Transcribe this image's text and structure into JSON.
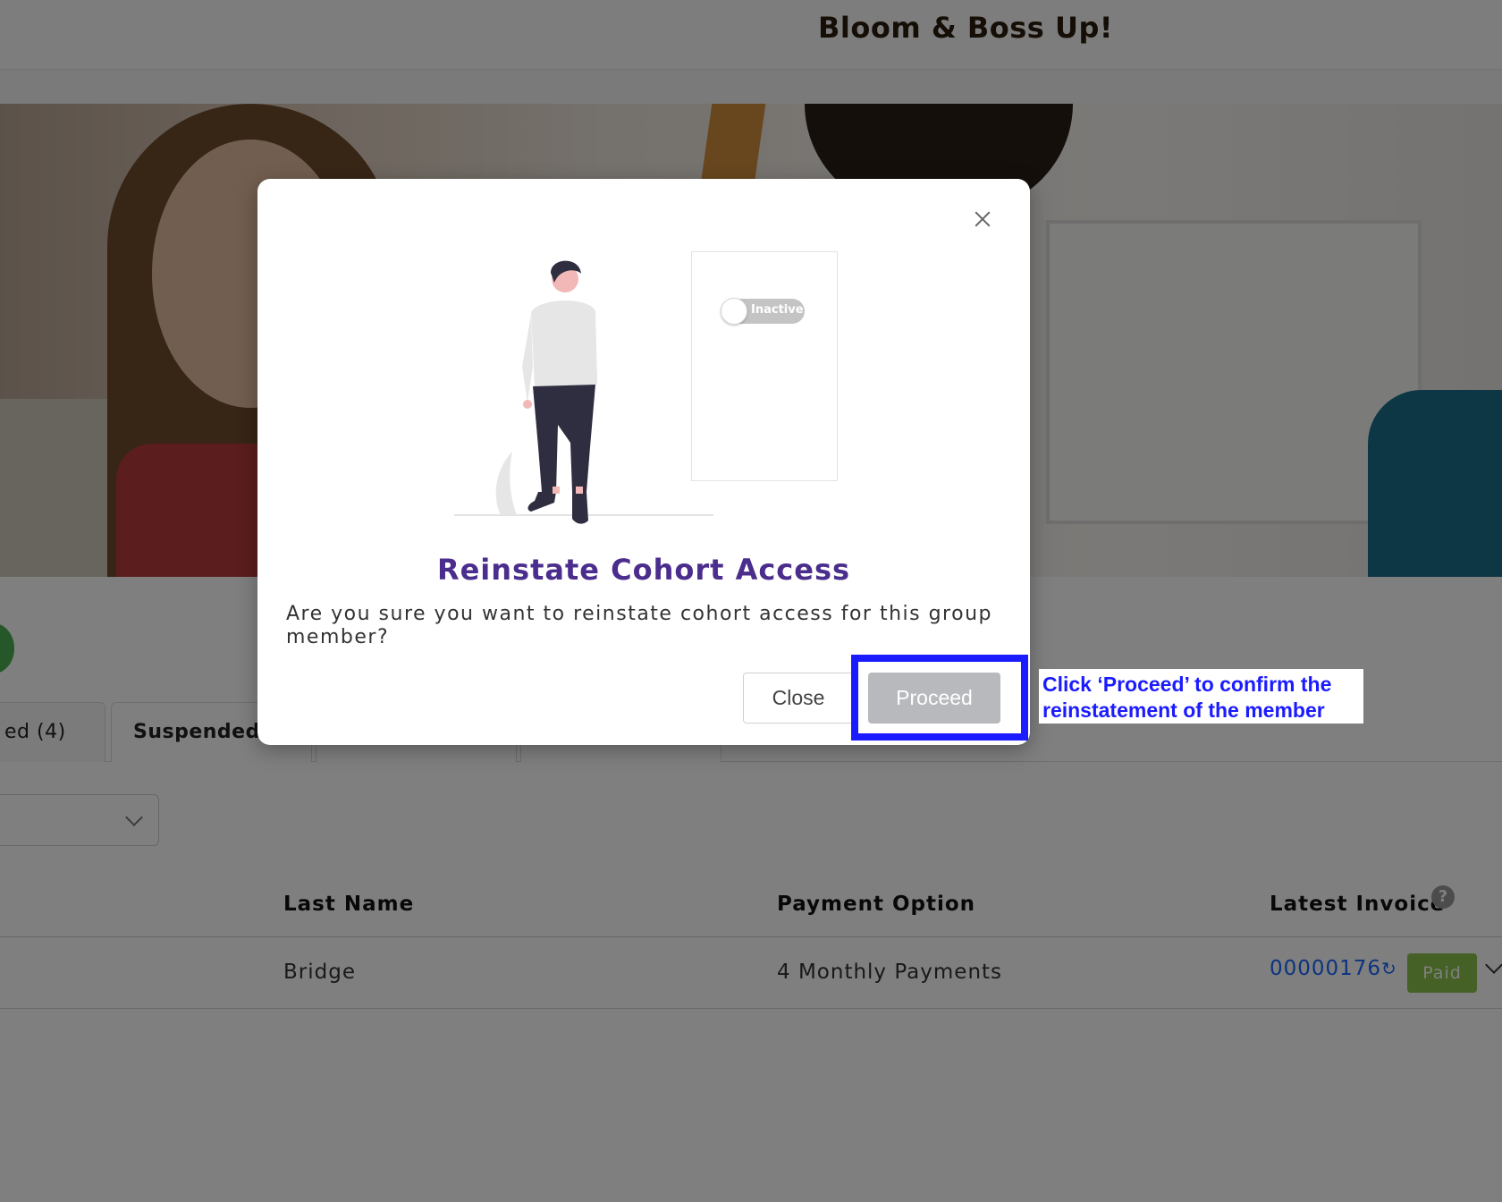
{
  "header": {
    "brand": "Bloom & Boss Up!"
  },
  "tabs": [
    {
      "label": "ed (4)"
    },
    {
      "label": "Suspended"
    }
  ],
  "table": {
    "columns": {
      "last_name": "Last Name",
      "payment_option": "Payment Option",
      "latest_invoice": "Latest Invoice"
    },
    "rows": [
      {
        "last_name": "Bridge",
        "payment_option": "4 Monthly Payments",
        "invoice": "00000176",
        "status": "Paid"
      }
    ]
  },
  "modal": {
    "toggle_label": "Inactive",
    "title": "Reinstate Cohort Access",
    "message": "Are you sure you want to reinstate cohort access for this group member?",
    "close_label": "Close",
    "proceed_label": "Proceed"
  },
  "callout": {
    "text": "Click ‘Proceed’ to confirm the reinstatement of the member"
  },
  "colors": {
    "title": "#4a2d8c",
    "highlight": "#1b1bff",
    "proceed_button": "#b7b9bd",
    "paid_badge": "#8bc34a",
    "invoice_link": "#1a66ff"
  },
  "icons": [
    "close-icon",
    "help-icon",
    "refresh-icon",
    "chevron-down-icon"
  ]
}
